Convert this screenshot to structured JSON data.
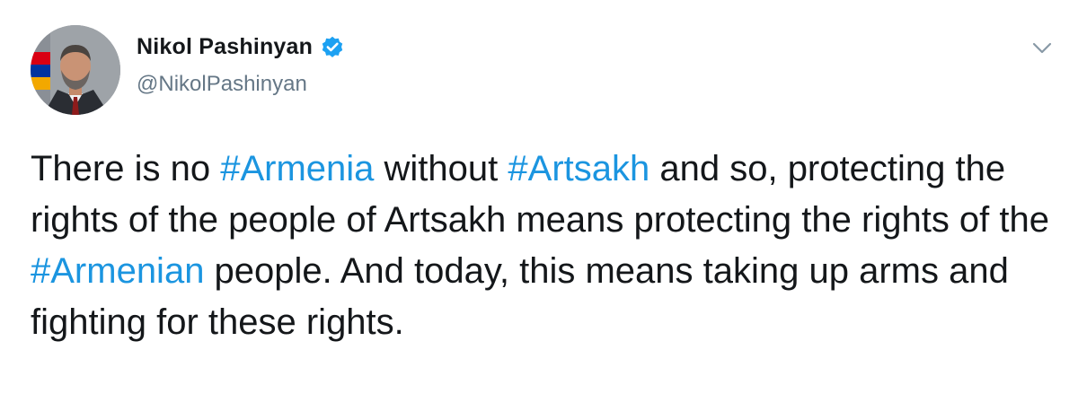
{
  "author": {
    "display_name": "Nikol Pashinyan",
    "handle": "@NikolPashinyan",
    "verified_icon": "verified-badge-icon",
    "avatar_icon": "profile-photo"
  },
  "menu": {
    "icon": "chevron-down-icon"
  },
  "tweet": {
    "segments": {
      "s1": "There is no ",
      "h1": "#Armenia",
      "s2": " without ",
      "h2": "#Artsakh",
      "s3": " and so, protecting the rights of the people of Artsakh means protecting the rights of the ",
      "h3": "#Armenian",
      "s4": " people. And today, this means taking up arms and fighting for these rights."
    }
  },
  "colors": {
    "hashtag": "#1b95e0",
    "text": "#14171a",
    "secondary": "#657786",
    "verified": "#1da1f2"
  }
}
